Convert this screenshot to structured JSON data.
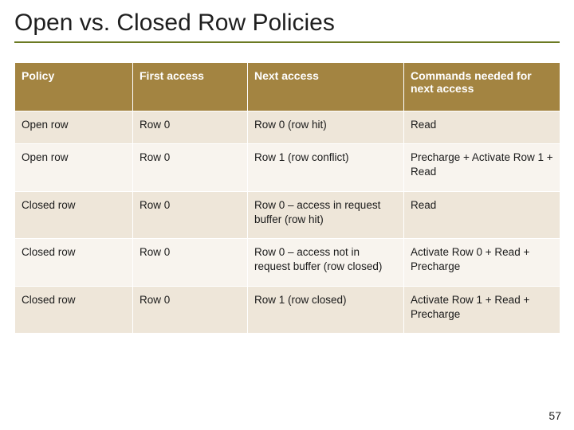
{
  "title": "Open vs. Closed Row Policies",
  "headers": {
    "c0": "Policy",
    "c1": "First access",
    "c2": "Next access",
    "c3": "Commands needed for next access"
  },
  "rows": [
    {
      "policy": "Open row",
      "first": "Row 0",
      "next": "Row 0 (row hit)",
      "cmd": "Read"
    },
    {
      "policy": "Open row",
      "first": "Row 0",
      "next": "Row 1 (row conflict)",
      "cmd": "Precharge + Activate Row 1 + Read"
    },
    {
      "policy": "Closed row",
      "first": "Row 0",
      "next": "Row 0 – access in request buffer (row hit)",
      "cmd": "Read"
    },
    {
      "policy": "Closed row",
      "first": "Row 0",
      "next": "Row 0 – access not in request buffer (row closed)",
      "cmd": "Activate Row 0 + Read + Precharge"
    },
    {
      "policy": "Closed row",
      "first": "Row 0",
      "next": "Row 1 (row closed)",
      "cmd": "Activate Row 1 + Read + Precharge"
    }
  ],
  "page_number": "57",
  "chart_data": {
    "type": "table",
    "title": "Open vs. Closed Row Policies",
    "columns": [
      "Policy",
      "First access",
      "Next access",
      "Commands needed for next access"
    ],
    "rows": [
      [
        "Open row",
        "Row 0",
        "Row 0 (row hit)",
        "Read"
      ],
      [
        "Open row",
        "Row 0",
        "Row 1 (row conflict)",
        "Precharge + Activate Row 1 + Read"
      ],
      [
        "Closed row",
        "Row 0",
        "Row 0 – access in request buffer (row hit)",
        "Read"
      ],
      [
        "Closed row",
        "Row 0",
        "Row 0 – access not in request buffer (row closed)",
        "Activate Row 0 + Read + Precharge"
      ],
      [
        "Closed row",
        "Row 0",
        "Row 1 (row closed)",
        "Activate Row 1 + Read + Precharge"
      ]
    ]
  }
}
